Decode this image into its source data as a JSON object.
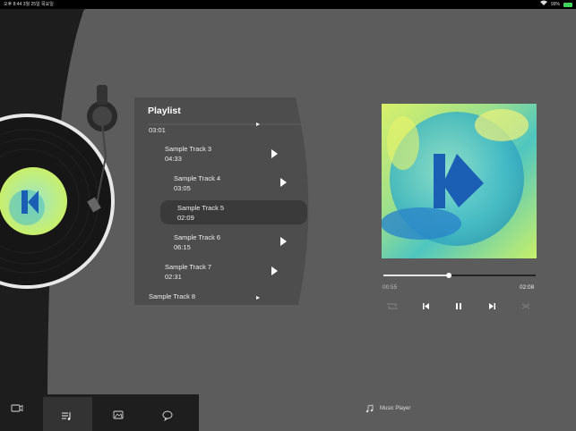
{
  "status_bar": {
    "left": "오후 8:44  3월 25일 목요일",
    "right": "99%"
  },
  "playlist": {
    "title": "Playlist",
    "tracks": [
      {
        "name": "",
        "duration": "03:01"
      },
      {
        "name": "Sample Track 3",
        "duration": "04:33"
      },
      {
        "name": "Sample Track 4",
        "duration": "03:05"
      },
      {
        "name": "Sample Track 5",
        "duration": "02:09"
      },
      {
        "name": "Sample Track 6",
        "duration": "06:15"
      },
      {
        "name": "Sample Track 7",
        "duration": "02:31"
      },
      {
        "name": "Sample Track 8",
        "duration": ""
      }
    ],
    "selected_index": 3
  },
  "player": {
    "elapsed": "00:55",
    "total": "02:08",
    "progress": 0.43
  },
  "footer": {
    "label": "Music Player"
  },
  "colors": {
    "panel": "#5c5c5c",
    "playlist_bg": "#4d4d4d",
    "selected_row": "#3a3a3a",
    "accent_blue": "#1a5fb4"
  }
}
